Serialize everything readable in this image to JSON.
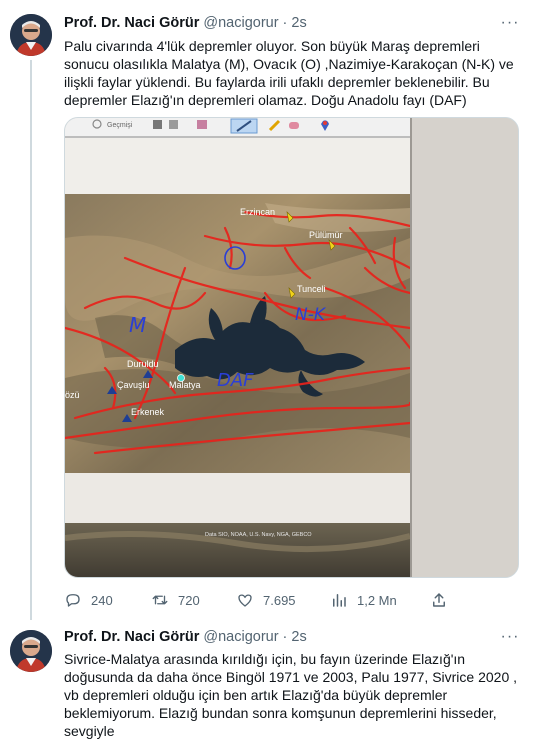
{
  "tweets": [
    {
      "author": {
        "name": "Prof. Dr. Naci Görür",
        "handle": "@nacigorur"
      },
      "time": "2s",
      "text": "Palu civarında 4'lük depremler oluyor. Son büyük Maraş depremleri sonucu olasılıkla Malatya (M), Ovacık (O) ,Nazimiye-Karakoçan (N-K) ve ilişkli faylar yüklendi.  Bu faylarda irili ufaklı depremler beklenebilir. Bu depremler Elazığ'ın depremleri olamaz. Doğu Anadolu fayı (DAF)",
      "media": {
        "toolbar_label": "Geçmişi",
        "attribution": "Data SIO, NOAA, U.S. Navy, NGA, GEBCO",
        "map_labels": {
          "erzincan": "Erzincan",
          "pulumur": "Pülümür",
          "tunceli": "Tunceli",
          "duruldu": "Duruldu",
          "cavuslu": "Çavuşlu",
          "malatya": "Malatya",
          "erkenek": "Erkenek",
          "ozu": "özü"
        },
        "annotations": {
          "m": "M",
          "o": "O",
          "nk": "N-K",
          "daf": "DAF"
        }
      },
      "stats": {
        "replies": "240",
        "retweets": "720",
        "likes": "7.695",
        "views": "1,2 Mn"
      }
    },
    {
      "author": {
        "name": "Prof. Dr. Naci Görür",
        "handle": "@nacigorur"
      },
      "time": "2s",
      "text": "Sivrice-Malatya arasında kırıldığı için, bu fayın üzerinde Elazığ'ın doğusunda da daha önce Bingöl 1971 ve 2003, Palu 1977, Sivrice 2020 , vb depremleri olduğu için ben artık  Elazığ'da büyük depremler beklemiyorum. Elazığ bundan sonra komşunun depremlerini hisseder, sevgiyle"
    }
  ],
  "colors": {
    "text": "#0f1419",
    "secondary": "#536471",
    "border": "#cfd9de",
    "fault": "#e8221b",
    "annotation": "#2a3fd6"
  }
}
